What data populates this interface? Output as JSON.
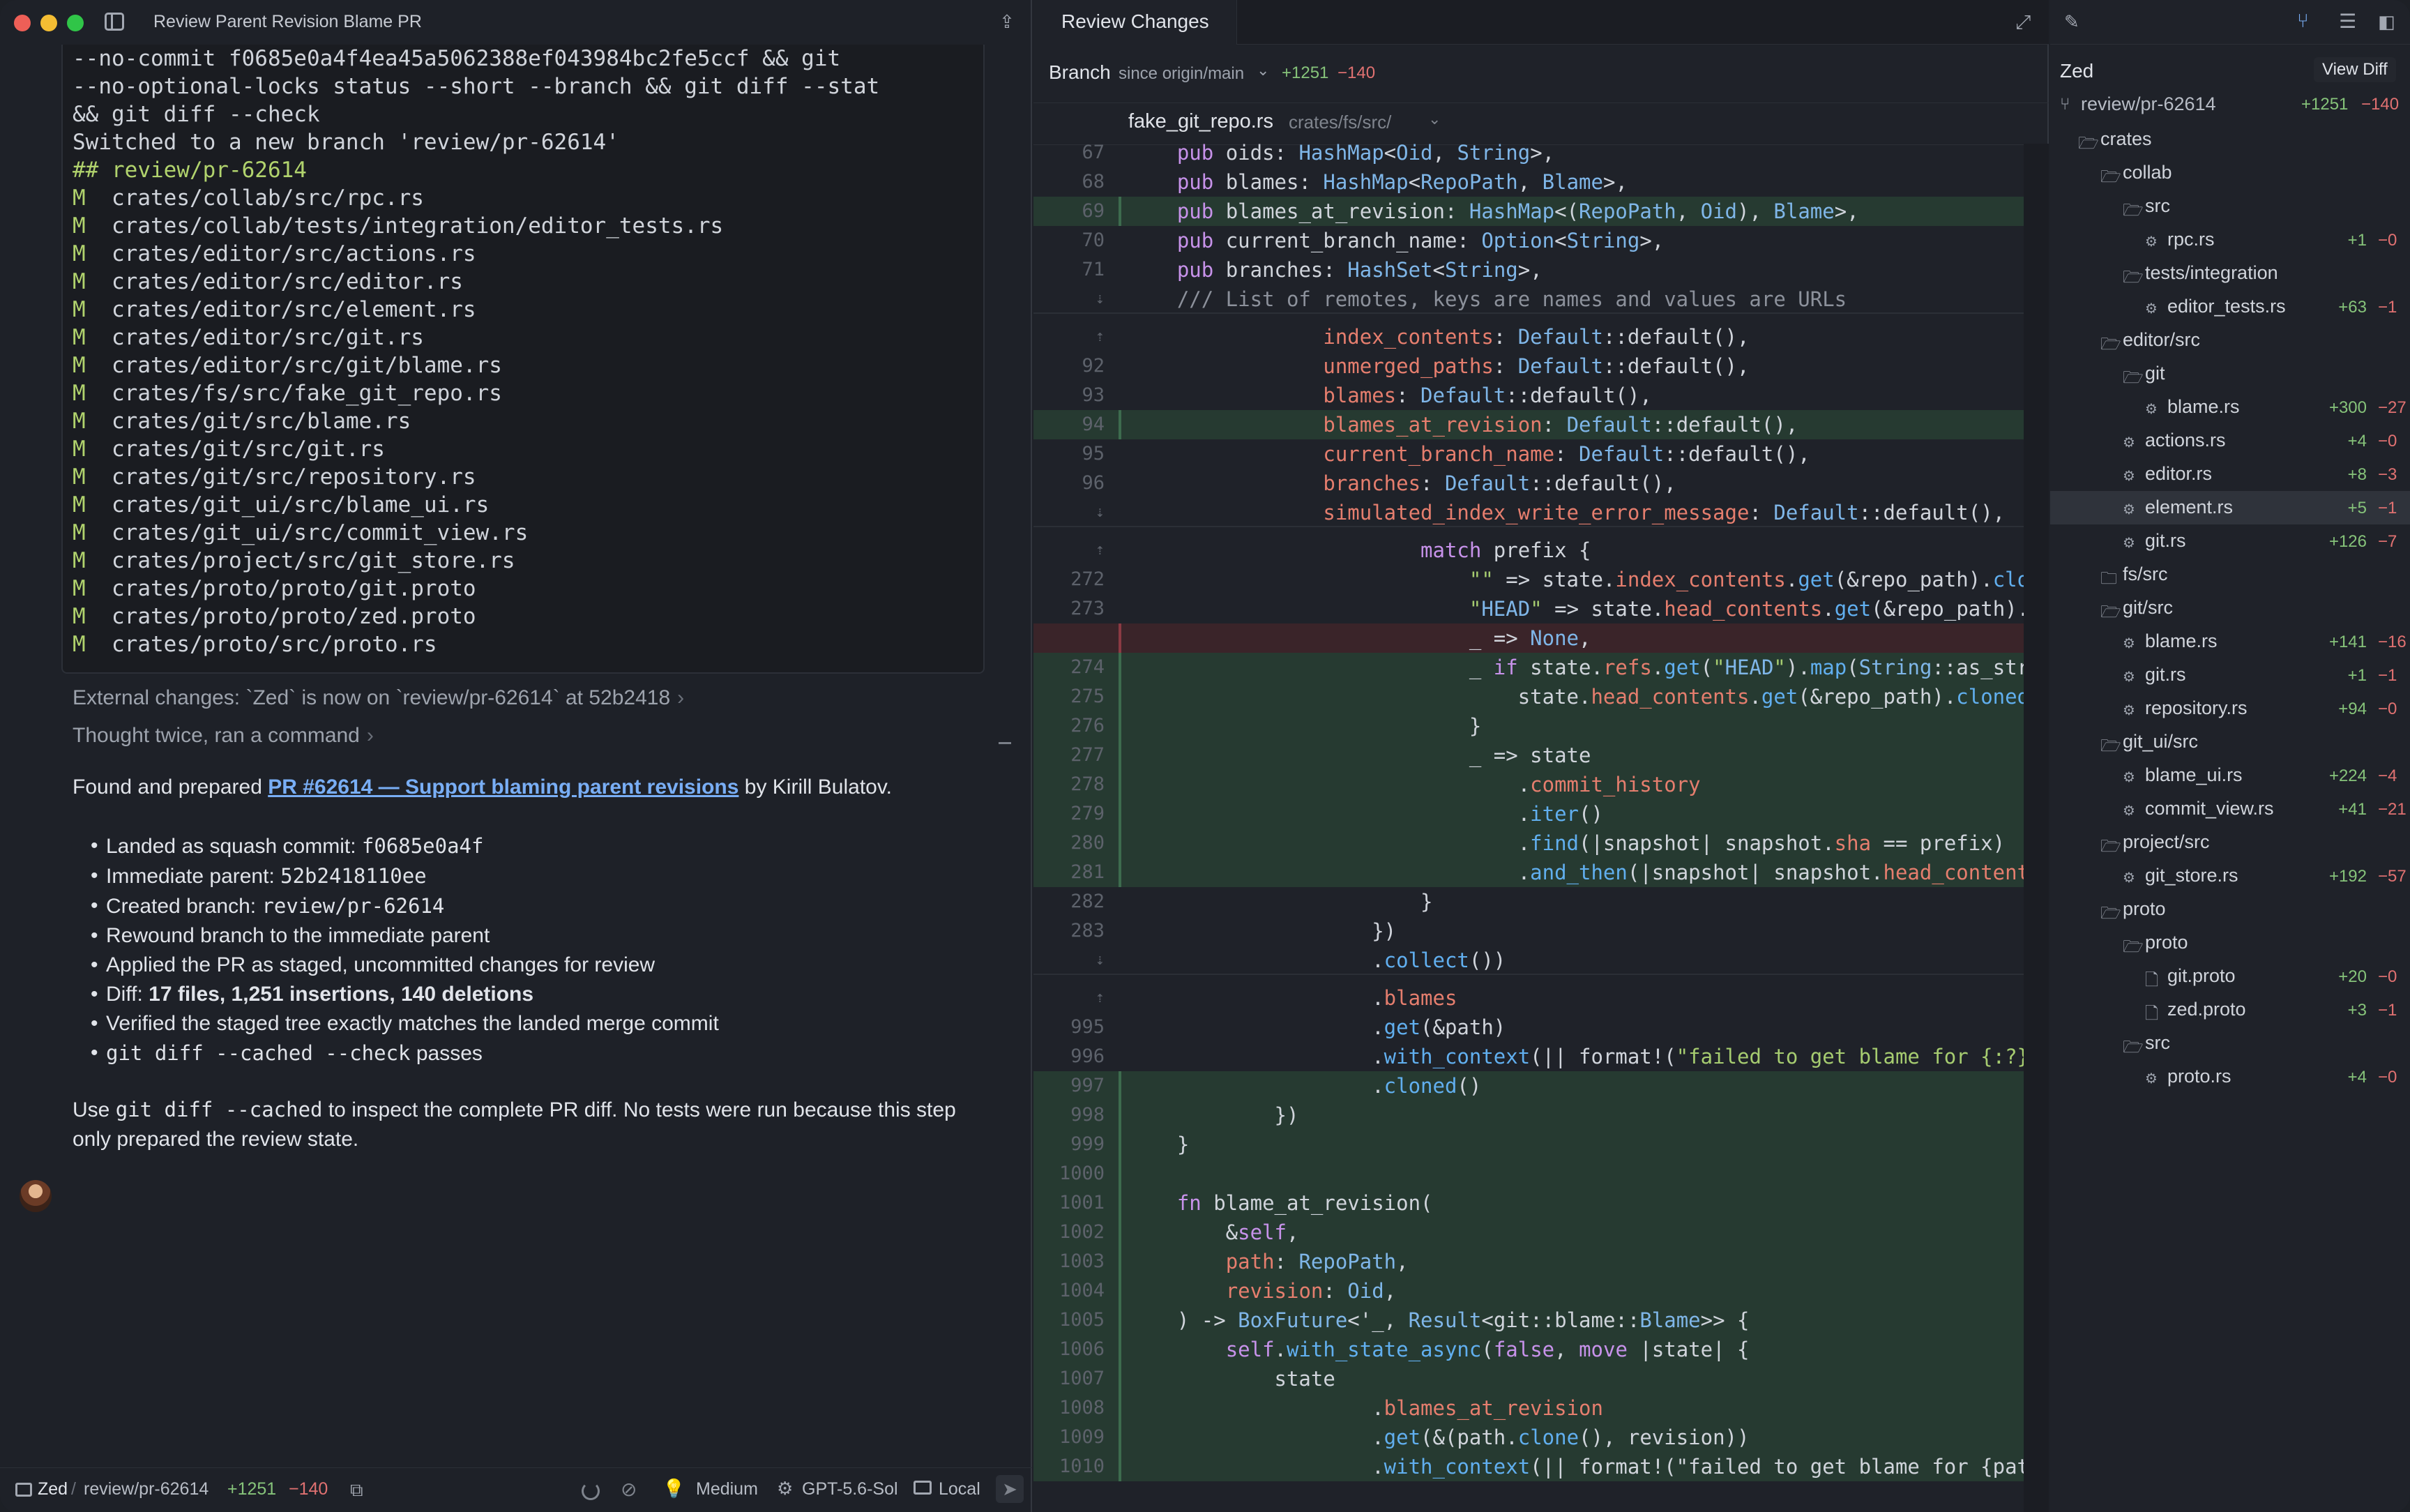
{
  "window": {
    "title": "Review Parent Revision Blame PR"
  },
  "terminal": {
    "lines": [
      {
        "text": "--no-commit f0685e0a4f4ea45a5062388ef043984bc2fe5ccf && git"
      },
      {
        "text": "--no-optional-locks status --short --branch && git diff --stat"
      },
      {
        "text": "&& git diff --check"
      },
      {
        "text": "Switched to a new branch 'review/pr-62614'"
      },
      {
        "status": "##",
        "text": "review/pr-62614"
      },
      {
        "status": "M",
        "text": "crates/collab/src/rpc.rs"
      },
      {
        "status": "M",
        "text": "crates/collab/tests/integration/editor_tests.rs"
      },
      {
        "status": "M",
        "text": "crates/editor/src/actions.rs"
      },
      {
        "status": "M",
        "text": "crates/editor/src/editor.rs"
      },
      {
        "status": "M",
        "text": "crates/editor/src/element.rs"
      },
      {
        "status": "M",
        "text": "crates/editor/src/git.rs"
      },
      {
        "status": "M",
        "text": "crates/editor/src/git/blame.rs"
      },
      {
        "status": "M",
        "text": "crates/fs/src/fake_git_repo.rs"
      },
      {
        "status": "M",
        "text": "crates/git/src/blame.rs"
      },
      {
        "status": "M",
        "text": "crates/git/src/git.rs"
      },
      {
        "status": "M",
        "text": "crates/git/src/repository.rs"
      },
      {
        "status": "M",
        "text": "crates/git_ui/src/blame_ui.rs"
      },
      {
        "status": "M",
        "text": "crates/git_ui/src/commit_view.rs"
      },
      {
        "status": "M",
        "text": "crates/project/src/git_store.rs"
      },
      {
        "status": "M",
        "text": "crates/proto/proto/git.proto"
      },
      {
        "status": "M",
        "text": "crates/proto/proto/zed.proto"
      },
      {
        "status": "M",
        "text": "crates/proto/src/proto.rs"
      }
    ]
  },
  "thread": {
    "external_changes": "External changes: `Zed` is now on `review/pr-62614` at 52b2418",
    "thought": "Thought twice, ran a command",
    "found_prefix": "Found and prepared ",
    "pr_link": "PR #62614 — Support blaming parent revisions",
    "found_suffix": " by Kirill Bulatov.",
    "bullets": [
      {
        "prefix": "Landed as squash commit: ",
        "code": "f0685e0a4f",
        "bold": "",
        "suffix": ""
      },
      {
        "prefix": "Immediate parent: ",
        "code": "52b2418110ee",
        "bold": "",
        "suffix": ""
      },
      {
        "prefix": "Created branch: ",
        "code": "review/pr-62614",
        "bold": "",
        "suffix": ""
      },
      {
        "prefix": "Rewound branch to the immediate parent",
        "code": "",
        "bold": "",
        "suffix": ""
      },
      {
        "prefix": "Applied the PR as staged, uncommitted changes for review",
        "code": "",
        "bold": "",
        "suffix": ""
      },
      {
        "prefix": "Diff: ",
        "code": "",
        "bold": "17 files, 1,251 insertions, 140 deletions",
        "suffix": ""
      },
      {
        "prefix": "Verified the staged tree exactly matches the landed merge commit",
        "code": "",
        "bold": "",
        "suffix": ""
      },
      {
        "prefix": "",
        "code": "git diff --cached --check",
        "bold": "",
        "suffix": " passes"
      }
    ],
    "closing_prefix": "Use ",
    "closing_code": "git diff --cached",
    "closing_suffix": " to inspect the complete PR diff. No tests were run because this step only prepared the review state."
  },
  "statusbar": {
    "project": "Zed",
    "separator": "/",
    "branch": "review/pr-62614",
    "additions": "+1251",
    "deletions": "−140",
    "mode": "Medium",
    "model": "GPT-5.6-Sol",
    "location": "Local"
  },
  "review": {
    "tab_label": "Review Changes",
    "branch_label": "Branch",
    "since": "since origin/main",
    "additions": "+1251",
    "deletions": "−140",
    "file_name": "fake_git_repo.rs",
    "file_path": "crates/fs/src/",
    "code_lines": [
      {
        "ln": "67",
        "kind": "ctx",
        "text": "    pub oids: HashMap<Oid, String>,"
      },
      {
        "ln": "68",
        "kind": "ctx",
        "text": "    pub blames: HashMap<RepoPath, Blame>,"
      },
      {
        "ln": "69",
        "kind": "add",
        "text": "    pub blames_at_revision: HashMap<(RepoPath, Oid), Blame>,"
      },
      {
        "ln": "70",
        "kind": "ctx",
        "text": "    pub current_branch_name: Option<String>,"
      },
      {
        "ln": "71",
        "kind": "ctx",
        "text": "    pub branches: HashSet<String>,"
      },
      {
        "ln": "⇣",
        "kind": "sep",
        "text": "    /// List of remotes, keys are names and values are URLs"
      },
      {
        "ln": "⇡",
        "kind": "ctx",
        "text": "                index_contents: Default::default(),"
      },
      {
        "ln": "92",
        "kind": "ctx",
        "text": "                unmerged_paths: Default::default(),"
      },
      {
        "ln": "93",
        "kind": "ctx",
        "text": "                blames: Default::default(),"
      },
      {
        "ln": "94",
        "kind": "add",
        "text": "                blames_at_revision: Default::default(),"
      },
      {
        "ln": "95",
        "kind": "ctx",
        "text": "                current_branch_name: Default::default(),"
      },
      {
        "ln": "96",
        "kind": "ctx",
        "text": "                branches: Default::default(),"
      },
      {
        "ln": "⇣",
        "kind": "sep",
        "text": "                simulated_index_write_error_message: Default::default(),"
      },
      {
        "ln": "⇡",
        "kind": "ctx",
        "text": "                        match prefix {"
      },
      {
        "ln": "272",
        "kind": "ctx",
        "text": "                            \"\" => state.index_contents.get(&repo_path).cloned(),"
      },
      {
        "ln": "273",
        "kind": "ctx",
        "text": "                            \"HEAD\" => state.head_contents.get(&repo_path).cloned(),"
      },
      {
        "ln": "",
        "kind": "del",
        "text": "                            _ => None,"
      },
      {
        "ln": "274",
        "kind": "add",
        "text": "                            _ if state.refs.get(\"HEAD\").map(String::as_str)"
      },
      {
        "ln": "275",
        "kind": "add",
        "text": "                                state.head_contents.get(&repo_path).cloned()"
      },
      {
        "ln": "276",
        "kind": "add",
        "text": "                            }"
      },
      {
        "ln": "277",
        "kind": "add",
        "text": "                            _ => state"
      },
      {
        "ln": "278",
        "kind": "add",
        "text": "                                .commit_history"
      },
      {
        "ln": "279",
        "kind": "add",
        "text": "                                .iter()"
      },
      {
        "ln": "280",
        "kind": "add",
        "text": "                                .find(|snapshot| snapshot.sha == prefix)"
      },
      {
        "ln": "281",
        "kind": "add",
        "text": "                                .and_then(|snapshot| snapshot.head_contents"
      },
      {
        "ln": "282",
        "kind": "ctx",
        "text": "                        }"
      },
      {
        "ln": "283",
        "kind": "ctx",
        "text": "                    })"
      },
      {
        "ln": "⇣",
        "kind": "sep",
        "text": "                    .collect())"
      },
      {
        "ln": "⇡",
        "kind": "ctx",
        "text": "                    .blames"
      },
      {
        "ln": "995",
        "kind": "ctx",
        "text": "                    .get(&path)"
      },
      {
        "ln": "996",
        "kind": "ctx",
        "text": "                    .with_context(|| format!(\"failed to get blame for {:?}\","
      },
      {
        "ln": "997",
        "kind": "add",
        "text": "                    .cloned()"
      },
      {
        "ln": "998",
        "kind": "add",
        "text": "            })"
      },
      {
        "ln": "999",
        "kind": "add",
        "text": "    }"
      },
      {
        "ln": "1000",
        "kind": "add",
        "text": ""
      },
      {
        "ln": "1001",
        "kind": "add",
        "text": "    fn blame_at_revision("
      },
      {
        "ln": "1002",
        "kind": "add",
        "text": "        &self,"
      },
      {
        "ln": "1003",
        "kind": "add",
        "text": "        path: RepoPath,"
      },
      {
        "ln": "1004",
        "kind": "add",
        "text": "        revision: Oid,"
      },
      {
        "ln": "1005",
        "kind": "add",
        "text": "    ) -> BoxFuture<'_, Result<git::blame::Blame>> {"
      },
      {
        "ln": "1006",
        "kind": "add",
        "text": "        self.with_state_async(false, move |state| {"
      },
      {
        "ln": "1007",
        "kind": "add",
        "text": "            state"
      },
      {
        "ln": "1008",
        "kind": "add",
        "text": "                    .blames_at_revision"
      },
      {
        "ln": "1009",
        "kind": "add",
        "text": "                    .get(&(path.clone(), revision))"
      },
      {
        "ln": "1010",
        "kind": "add",
        "text": "                    .with_context(|| format!(\"failed to get blame for {path"
      }
    ]
  },
  "tree": {
    "project": "Zed",
    "view_diff": "View Diff",
    "branch": "review/pr-62614",
    "branch_add": "+1251",
    "branch_del": "−140",
    "rows": [
      {
        "label": "crates",
        "depth": 0,
        "type": "folder",
        "add": "",
        "del": ""
      },
      {
        "label": "collab",
        "depth": 1,
        "type": "folder",
        "add": "",
        "del": ""
      },
      {
        "label": "src",
        "depth": 2,
        "type": "folder",
        "add": "",
        "del": ""
      },
      {
        "label": "rpc.rs",
        "depth": 3,
        "type": "rust",
        "add": "+1",
        "del": "−0"
      },
      {
        "label": "tests/integration",
        "depth": 2,
        "type": "folder",
        "add": "",
        "del": ""
      },
      {
        "label": "editor_tests.rs",
        "depth": 3,
        "type": "rust",
        "add": "+63",
        "del": "−1"
      },
      {
        "label": "editor/src",
        "depth": 1,
        "type": "folder",
        "add": "",
        "del": ""
      },
      {
        "label": "git",
        "depth": 2,
        "type": "folder",
        "add": "",
        "del": ""
      },
      {
        "label": "blame.rs",
        "depth": 3,
        "type": "rust",
        "add": "+300",
        "del": "−27"
      },
      {
        "label": "actions.rs",
        "depth": 2,
        "type": "rust",
        "add": "+4",
        "del": "−0"
      },
      {
        "label": "editor.rs",
        "depth": 2,
        "type": "rust",
        "add": "+8",
        "del": "−3"
      },
      {
        "label": "element.rs",
        "depth": 2,
        "type": "rust",
        "add": "+5",
        "del": "−1",
        "selected": true
      },
      {
        "label": "git.rs",
        "depth": 2,
        "type": "rust",
        "add": "+126",
        "del": "−7"
      },
      {
        "label": "fs/src",
        "depth": 1,
        "type": "folder-closed",
        "add": "",
        "del": ""
      },
      {
        "label": "git/src",
        "depth": 1,
        "type": "folder",
        "add": "",
        "del": ""
      },
      {
        "label": "blame.rs",
        "depth": 2,
        "type": "rust",
        "add": "+141",
        "del": "−16"
      },
      {
        "label": "git.rs",
        "depth": 2,
        "type": "rust",
        "add": "+1",
        "del": "−1"
      },
      {
        "label": "repository.rs",
        "depth": 2,
        "type": "rust",
        "add": "+94",
        "del": "−0"
      },
      {
        "label": "git_ui/src",
        "depth": 1,
        "type": "folder",
        "add": "",
        "del": ""
      },
      {
        "label": "blame_ui.rs",
        "depth": 2,
        "type": "rust",
        "add": "+224",
        "del": "−4"
      },
      {
        "label": "commit_view.rs",
        "depth": 2,
        "type": "rust",
        "add": "+41",
        "del": "−21"
      },
      {
        "label": "project/src",
        "depth": 1,
        "type": "folder",
        "add": "",
        "del": ""
      },
      {
        "label": "git_store.rs",
        "depth": 2,
        "type": "rust",
        "add": "+192",
        "del": "−57"
      },
      {
        "label": "proto",
        "depth": 1,
        "type": "folder",
        "add": "",
        "del": ""
      },
      {
        "label": "proto",
        "depth": 2,
        "type": "folder",
        "add": "",
        "del": ""
      },
      {
        "label": "git.proto",
        "depth": 3,
        "type": "file",
        "add": "+20",
        "del": "−0"
      },
      {
        "label": "zed.proto",
        "depth": 3,
        "type": "file",
        "add": "+3",
        "del": "−1"
      },
      {
        "label": "src",
        "depth": 2,
        "type": "folder",
        "add": "",
        "del": ""
      },
      {
        "label": "proto.rs",
        "depth": 3,
        "type": "rust",
        "add": "+4",
        "del": "−0"
      }
    ]
  },
  "icons": {
    "share": "share-icon",
    "expand": "expand-icon",
    "branch": "git-branch-icon",
    "folder": "folder-icon",
    "rust": "rust-file-icon"
  }
}
